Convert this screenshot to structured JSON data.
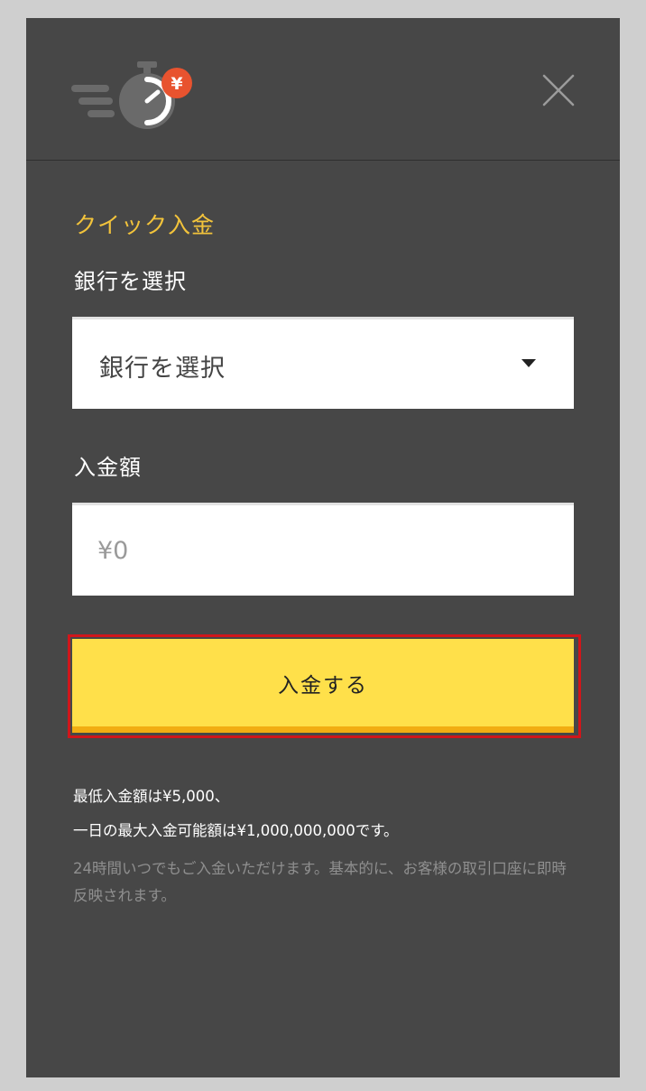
{
  "header": {
    "logo_icon": "stopwatch-yen-icon",
    "logo_badge": "¥",
    "close_icon": "close-icon"
  },
  "form": {
    "title": "クイック入金",
    "bank_label": "銀行を選択",
    "bank_select_value": "銀行を選択",
    "amount_label": "入金額",
    "amount_placeholder": "¥0",
    "amount_value": "",
    "submit_label": "入金する"
  },
  "notes": {
    "line1": "最低入金額は¥5,000、",
    "line2": "一日の最大入金可能額は¥1,000,000,000です。",
    "sub": "24時間いつでもご入金いただけます。基本的に、お客様の取引口座に即時反映されます。"
  },
  "colors": {
    "panel_bg": "#474747",
    "accent_title": "#f2c33b",
    "button_bg": "#ffe04a",
    "button_shadow": "#f2ad12",
    "highlight_border": "#d0161b",
    "badge": "#e8532f"
  }
}
